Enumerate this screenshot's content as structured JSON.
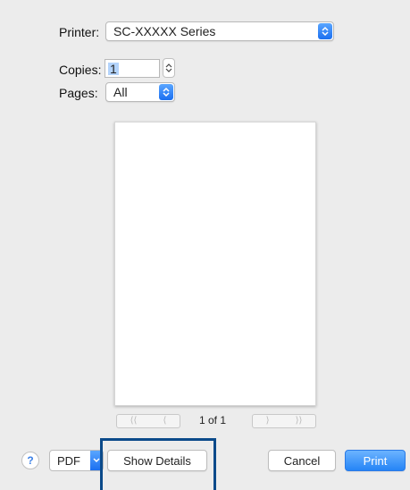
{
  "printer": {
    "label": "Printer:",
    "value": "SC-XXXXX Series"
  },
  "copies": {
    "label": "Copies:",
    "value": "1"
  },
  "pages": {
    "label": "Pages:",
    "value": "All"
  },
  "preview": {
    "prev_first": "⟨⟨",
    "prev": "⟨",
    "page_count": "1 of 1",
    "next": "⟩",
    "next_last": "⟩⟩"
  },
  "bottom": {
    "help": "?",
    "pdf": "PDF",
    "show_details": "Show Details",
    "cancel": "Cancel",
    "print": "Print"
  },
  "colors": {
    "accent": "#2585f6",
    "highlight_box": "#0b4a8a"
  }
}
